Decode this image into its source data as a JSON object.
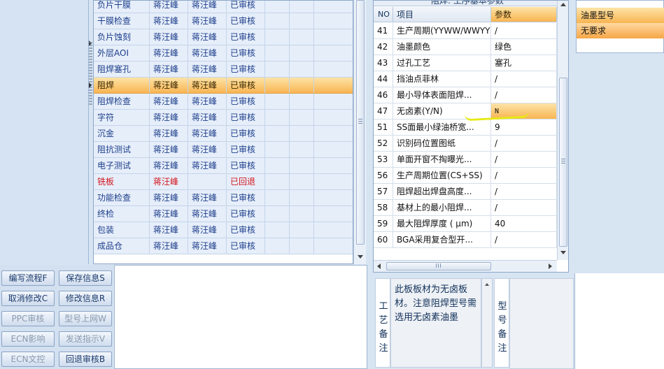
{
  "process_grid": {
    "rows": [
      {
        "name": "负片干膜",
        "a": "蒋汪峰",
        "b": "蒋汪峰",
        "status": "已审核",
        "state": "normal"
      },
      {
        "name": "干膜检查",
        "a": "蒋汪峰",
        "b": "蒋汪峰",
        "status": "已审核",
        "state": "normal"
      },
      {
        "name": "负片蚀刻",
        "a": "蒋汪峰",
        "b": "蒋汪峰",
        "status": "已审核",
        "state": "normal"
      },
      {
        "name": "外层AOI",
        "a": "蒋汪峰",
        "b": "蒋汪峰",
        "status": "已审核",
        "state": "normal"
      },
      {
        "name": "阻焊塞孔",
        "a": "蒋汪峰",
        "b": "蒋汪峰",
        "status": "已审核",
        "state": "normal"
      },
      {
        "name": "阻焊",
        "a": "蒋汪峰",
        "b": "蒋汪峰",
        "status": "已审核",
        "state": "selected"
      },
      {
        "name": "阻焊检查",
        "a": "蒋汪峰",
        "b": "蒋汪峰",
        "status": "已审核",
        "state": "normal"
      },
      {
        "name": "字符",
        "a": "蒋汪峰",
        "b": "蒋汪峰",
        "status": "已审核",
        "state": "normal"
      },
      {
        "name": "沉金",
        "a": "蒋汪峰",
        "b": "蒋汪峰",
        "status": "已审核",
        "state": "normal"
      },
      {
        "name": "阻抗测试",
        "a": "蒋汪峰",
        "b": "蒋汪峰",
        "status": "已审核",
        "state": "normal"
      },
      {
        "name": "电子测试",
        "a": "蒋汪峰",
        "b": "蒋汪峰",
        "status": "已审核",
        "state": "normal"
      },
      {
        "name": "铣板",
        "a": "蒋汪峰",
        "b": "",
        "status": "已回退",
        "state": "returned"
      },
      {
        "name": "功能检查",
        "a": "蒋汪峰",
        "b": "蒋汪峰",
        "status": "已审核",
        "state": "normal"
      },
      {
        "name": "终检",
        "a": "蒋汪峰",
        "b": "蒋汪峰",
        "status": "已审核",
        "state": "normal"
      },
      {
        "name": "包装",
        "a": "蒋汪峰",
        "b": "蒋汪峰",
        "status": "已审核",
        "state": "normal"
      },
      {
        "name": "成品仓",
        "a": "蒋汪峰",
        "b": "蒋汪峰",
        "status": "已审核",
        "state": "normal"
      }
    ]
  },
  "buttons": [
    {
      "label": "编写流程F",
      "enabled": true
    },
    {
      "label": "保存信息S",
      "enabled": true
    },
    {
      "label": "取消修改C",
      "enabled": true
    },
    {
      "label": "修改信息R",
      "enabled": true
    },
    {
      "label": "PPC审核",
      "enabled": false
    },
    {
      "label": "型号上网W",
      "enabled": false
    },
    {
      "label": "ECN影响",
      "enabled": false
    },
    {
      "label": "发送指示V",
      "enabled": false
    },
    {
      "label": "ECN文控",
      "enabled": false
    },
    {
      "label": "回退审核B",
      "enabled": true
    }
  ],
  "params": {
    "panel_title": "阻焊: 工序基本参数",
    "headers": {
      "no": "NO",
      "item": "项目",
      "value": "参数"
    },
    "rows": [
      {
        "no": "41",
        "item": "生产周期(YYWW/WWYY)",
        "value": "/"
      },
      {
        "no": "42",
        "item": "油墨颜色",
        "value": "绿色"
      },
      {
        "no": "43",
        "item": "过孔工艺",
        "value": "塞孔"
      },
      {
        "no": "44",
        "item": "挡油点菲林",
        "value": "/"
      },
      {
        "no": "46",
        "item": "最小导体表面阻焊...",
        "value": "/"
      },
      {
        "no": "47",
        "item": "无卤素(Y/N)",
        "value": "N",
        "selected": true
      },
      {
        "no": "51",
        "item": "SS面最小绿油桥宽...",
        "value": "9"
      },
      {
        "no": "52",
        "item": "识别码位置图纸",
        "value": "/"
      },
      {
        "no": "53",
        "item": "单面开窗不掏曝光...",
        "value": "/"
      },
      {
        "no": "56",
        "item": "生产周期位置(CS+SS)",
        "value": "/"
      },
      {
        "no": "57",
        "item": "阻焊超出焊盘高度...",
        "value": "/"
      },
      {
        "no": "58",
        "item": "基材上的最小阻焊...",
        "value": "/"
      },
      {
        "no": "59",
        "item": "最大阻焊厚度 ( μm)",
        "value": "40"
      },
      {
        "no": "60",
        "item": "BGA采用复合型开...",
        "value": "/"
      }
    ]
  },
  "ink": {
    "header": "油墨型号",
    "value": "无要求"
  },
  "notes": {
    "craft_label": [
      "工",
      "艺",
      "备",
      "注"
    ],
    "craft_text": "此板板材为无卤板材。注意阻焊型号需选用无卤素油墨",
    "model_label": [
      "型",
      "号",
      "备",
      "注"
    ]
  },
  "colors": {
    "selection": "#f8b552",
    "returned_text": "#d3151c",
    "panel_bg": "#d7e4f2"
  }
}
